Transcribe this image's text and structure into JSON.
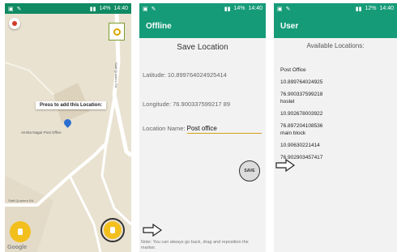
{
  "status": {
    "battery": "14%",
    "time": "14:40",
    "battery_3": "12%",
    "time_3": "14:40"
  },
  "map_screen": {
    "press_label": "Press to add this Location:",
    "place_label": "Amrita Nagar Post Office",
    "road_1": "Staff Quarters Rd",
    "road_2": "Staff Quarters Rd",
    "watermark": "Google",
    "icons": {
      "back": "record-dot-icon",
      "location": "my-location-icon",
      "list": "list-icon",
      "add": "add-location-icon",
      "pin": "map-pin-icon"
    }
  },
  "save_screen": {
    "appbar_title": "Offline",
    "page_title": "Save Location",
    "latitude": "Latitude: 10.899764024925414",
    "longitude": "Longitude: 76.900337599217 89",
    "location_label": "Location Name:",
    "location_value": "Post office",
    "save_label": "SAVE",
    "note": "Note: You can always go back, drag and reposition the marker."
  },
  "user_screen": {
    "appbar_title": "User",
    "heading": "Available Locations:",
    "locations": [
      {
        "name": "Post Office",
        "lat": "10.899764024925",
        "lng": "76.900337599218"
      },
      {
        "name": "hostel",
        "lat": "10.902678003922",
        "lng": "76.897204108536"
      },
      {
        "name": "main block",
        "lat": "10.90630221414",
        "lng": "76.902903457417"
      }
    ]
  },
  "colors": {
    "primary": "#169b79",
    "status": "#0f8a63",
    "accent": "#f2bf1d",
    "pin": "#2a6fd0"
  }
}
